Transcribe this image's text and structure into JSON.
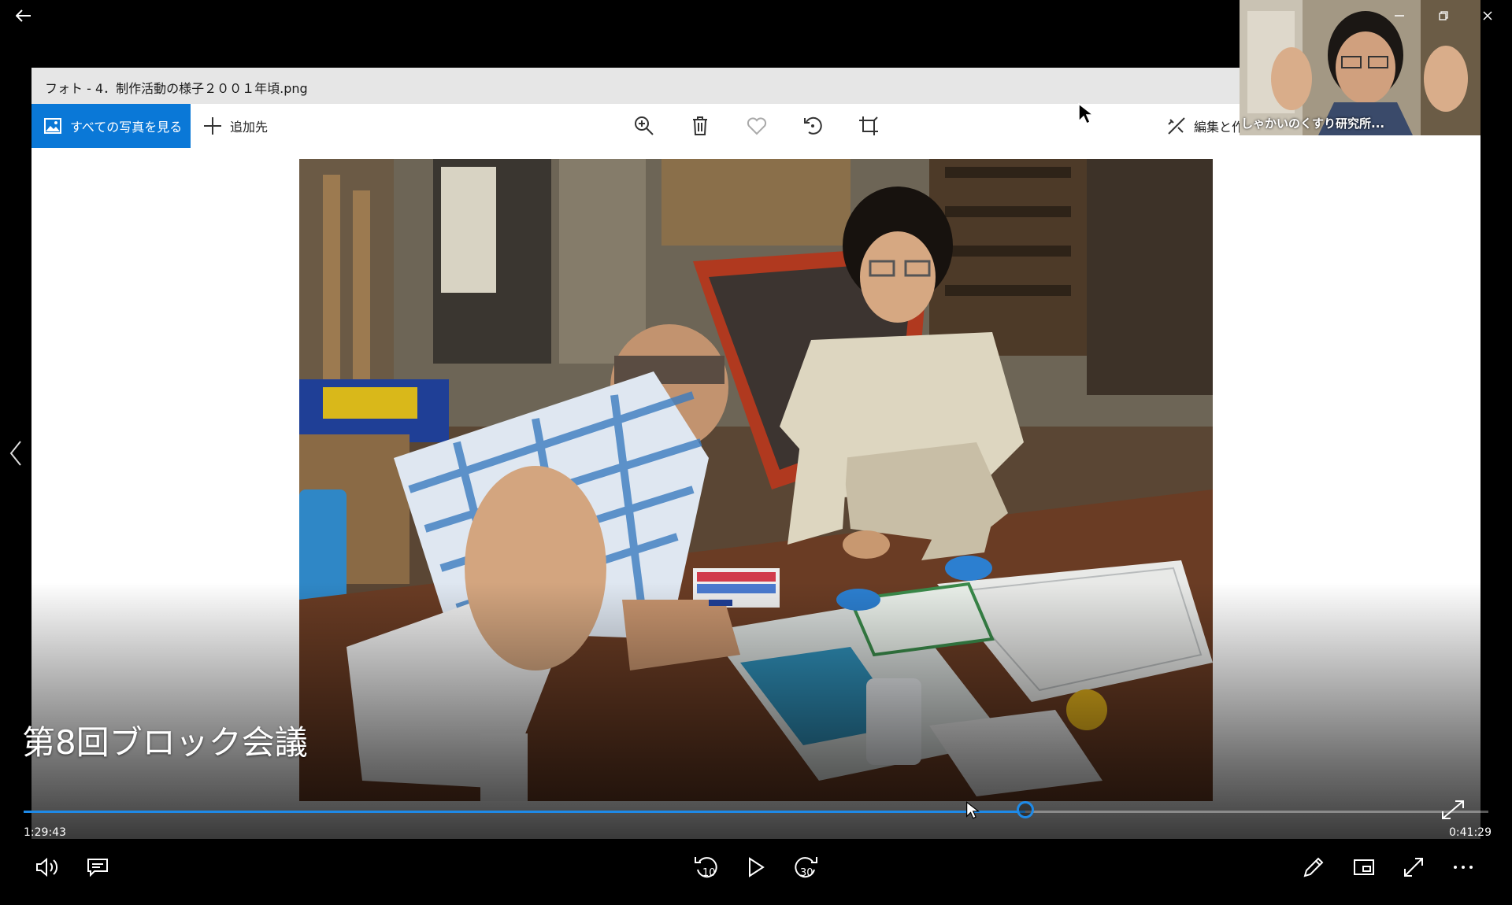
{
  "photos_app": {
    "title": "フォト - 4．制作活動の様子２００１年頃.png",
    "toolbar": {
      "see_all_label": "すべての写真を見る",
      "add_to_label": "追加先",
      "edit_create_label": "編集と作成",
      "icons": [
        "zoom-in-icon",
        "trash-icon",
        "heart-icon",
        "rotate-icon",
        "crop-icon"
      ]
    }
  },
  "player": {
    "video_title": "第8回ブロック会議",
    "elapsed": "1:29:43",
    "remaining": "0:41:29",
    "progress": 0.684,
    "accent_color": "#1e8ae8",
    "controls": [
      "volume-icon",
      "captions-icon",
      "skip-back-10-icon",
      "play-icon",
      "skip-forward-30-icon",
      "pen-icon",
      "mini-view-icon",
      "fullscreen-icon",
      "more-icon"
    ],
    "skip_back_seconds": "10",
    "skip_forward_seconds": "30"
  },
  "webcam": {
    "participant_name": "しゃかいのくすり研究所..."
  },
  "colors": {
    "photos_accent": "#0a78d7",
    "titlebar": "#e6e6e6"
  }
}
